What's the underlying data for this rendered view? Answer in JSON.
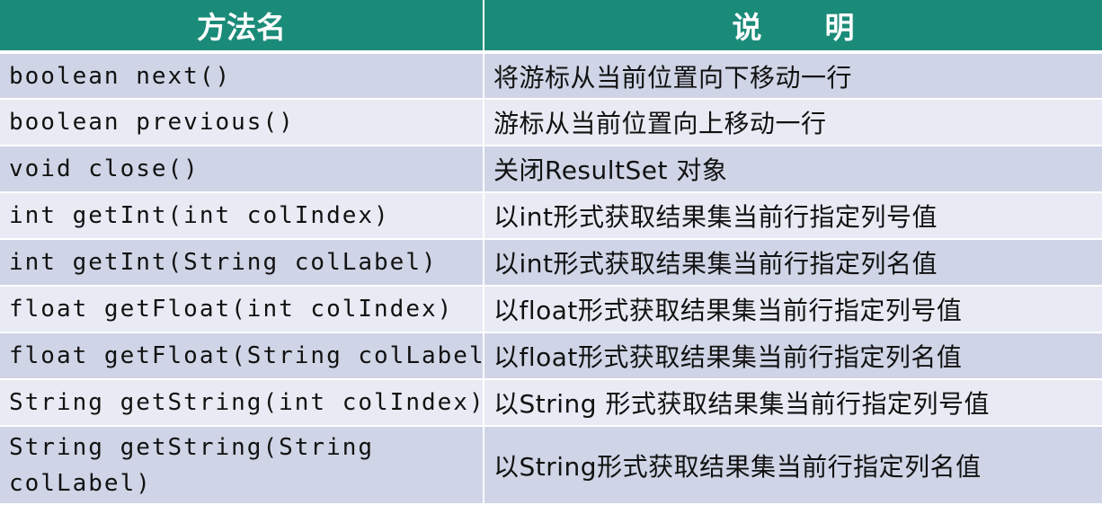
{
  "table": {
    "headers": {
      "method": "方法名",
      "description": "说明"
    },
    "rows": [
      {
        "method": "boolean next()",
        "description": "将游标从当前位置向下移动一行"
      },
      {
        "method": "boolean previous()",
        "description": "游标从当前位置向上移动一行"
      },
      {
        "method": "void close()",
        "description": "关闭ResultSet 对象"
      },
      {
        "method": "int getInt(int colIndex)",
        "description": "以int形式获取结果集当前行指定列号值"
      },
      {
        "method": "int getInt(String colLabel)",
        "description": "以int形式获取结果集当前行指定列名值"
      },
      {
        "method": "float getFloat(int colIndex)",
        "description": "以float形式获取结果集当前行指定列号值"
      },
      {
        "method": "float getFloat(String colLabel)",
        "description": "以float形式获取结果集当前行指定列名值"
      },
      {
        "method": "String getString(int colIndex)",
        "description": "以String 形式获取结果集当前行指定列号值"
      },
      {
        "method": "String getString(String colLabel)",
        "description": "以String形式获取结果集当前行指定列名值"
      }
    ]
  },
  "colors": {
    "header_bg": "#1b8b79",
    "header_text": "#ffffff",
    "row_odd_bg": "#cfd5e6",
    "row_even_bg": "#e9ebf4"
  }
}
